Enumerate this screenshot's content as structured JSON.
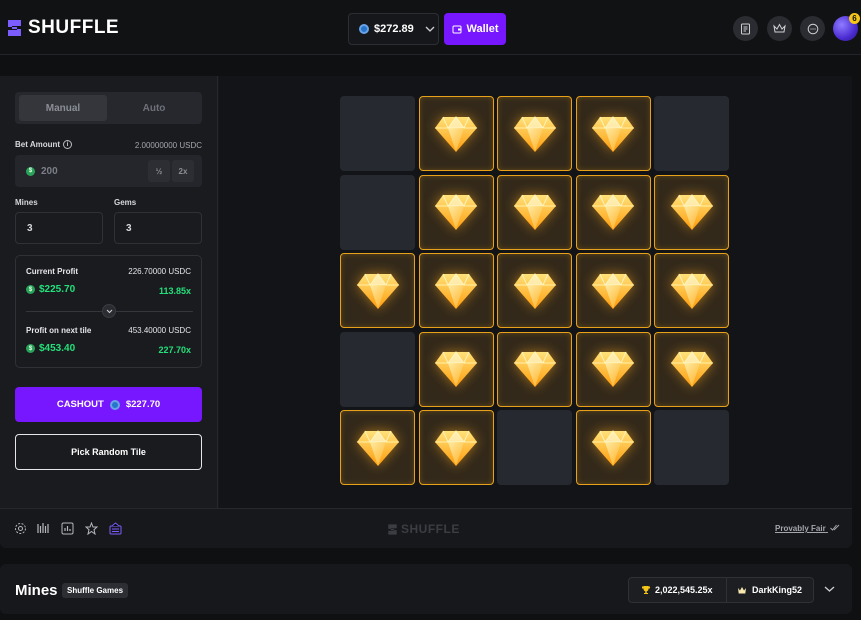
{
  "header": {
    "logo_text": "SHUFFLE",
    "balance": "$272.89",
    "wallet_label": "Wallet",
    "notification_count": "6"
  },
  "controls": {
    "tabs": [
      "Manual",
      "Auto"
    ],
    "active_tab": "Manual",
    "bet_amount_label": "Bet Amount",
    "bet_amount_usdc": "2.00000000 USDC",
    "bet_value": "200",
    "half_label": "½",
    "double_label": "2x",
    "mines_label": "Mines",
    "mines_value": "3",
    "gems_label": "Gems",
    "gems_value": "3",
    "current_profit_label": "Current Profit",
    "current_profit_usdc": "226.70000 USDC",
    "current_profit_amount": "$225.70",
    "current_profit_multiplier": "113.85x",
    "next_profit_label": "Profit on next tile",
    "next_profit_usdc": "453.40000 USDC",
    "next_profit_amount": "$453.40",
    "next_profit_multiplier": "227.70x",
    "cashout_label": "CASHOUT",
    "cashout_amount": "$227.70",
    "random_tile_label": "Pick Random Tile"
  },
  "board": {
    "rows": 5,
    "cols": 5,
    "tiles": [
      "hidden",
      "gem",
      "gem",
      "gem",
      "hidden",
      "hidden",
      "gem",
      "gem",
      "gem",
      "gem",
      "gem",
      "gem",
      "gem",
      "gem",
      "gem",
      "hidden",
      "gem",
      "gem",
      "gem",
      "gem",
      "gem",
      "gem",
      "hidden",
      "gem",
      "hidden"
    ]
  },
  "footer": {
    "logo_text": "SHUFFLE",
    "provably_fair": "Provably Fair"
  },
  "info_bar": {
    "title": "Mines",
    "badge": "Shuffle Games",
    "record_multiplier": "2,022,545.25x",
    "record_user": "DarkKing52"
  },
  "colors": {
    "accent": "#7717ff",
    "profit_green": "#22e07a",
    "gem_border": "#e8a21a"
  }
}
